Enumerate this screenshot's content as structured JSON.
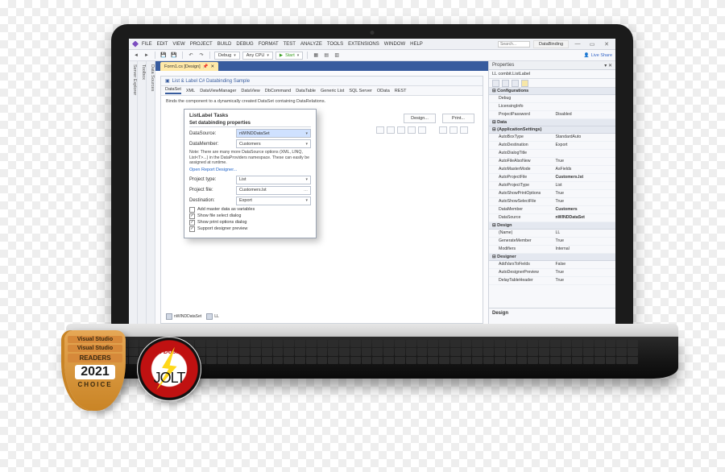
{
  "menu": [
    "FILE",
    "EDIT",
    "VIEW",
    "PROJECT",
    "BUILD",
    "DEBUG",
    "FORMAT",
    "TEST",
    "ANALYZE",
    "TOOLS",
    "EXTENSIONS",
    "WINDOW",
    "HELP"
  ],
  "search_ph": "Search...",
  "solution_tag": "DataBinding",
  "toolbar": {
    "config": "Debug",
    "platform": "Any CPU",
    "start": "Start"
  },
  "liveshare": "Live Share",
  "rails": [
    "Server Explorer",
    "Toolbox",
    "Data Sources"
  ],
  "doc_tab": "Form1.cs [Design]",
  "designer_title": "List & Label C# Databinding Sample",
  "ds_tabs": [
    "DataSet",
    "XML",
    "DataViewManager",
    "DataView",
    "DbCommand",
    "DataTable",
    "Generic List",
    "SQL Server",
    "OData",
    "REST"
  ],
  "ds_note": "Binds the component to a dynamically created DataSet containing DataRelations.",
  "btn_design": "Design...",
  "btn_print": "Print...",
  "popup": {
    "title": "ListLabel Tasks",
    "subtitle": "Set databinding properties",
    "datasource_lbl": "DataSource:",
    "datasource_val": "nWINDDataSet",
    "datamember_lbl": "DataMember:",
    "datamember_val": "Customers",
    "note": "Note: There are many more DataSource options (XML, LINQ, List<T>...) in the DataProviders namespace. These can easily be assigned at runtime.",
    "link": "Open Report Designer...",
    "projtype_lbl": "Project type:",
    "projtype_val": "List",
    "projfile_lbl": "Project file:",
    "projfile_val": "Customers.lst",
    "dest_lbl": "Destination:",
    "dest_val": "Export",
    "chk_master": "Add master data as variables",
    "chk_file": "Show file select dialog",
    "chk_print": "Show print options dialog",
    "chk_prev": "Support designer preview"
  },
  "tray": [
    "nWINDDataSet",
    "LL"
  ],
  "props": {
    "panel": "Properties",
    "selected": "LL  combit.ListLabel",
    "cats": [
      {
        "name": "Configurations",
        "items": [
          [
            "Debug",
            ""
          ],
          [
            "LicensingInfo",
            ""
          ],
          [
            "ProjectPassword",
            "Disabled"
          ]
        ]
      },
      {
        "name": "Data",
        "items": []
      },
      {
        "name": "(ApplicationSettings)",
        "items": [
          [
            "AutoBoxType",
            "StandardAuto"
          ],
          [
            "AutoDestination",
            "Export"
          ],
          [
            "AutoDialogTitle",
            ""
          ],
          [
            "AutoFileAlsoNew",
            "True"
          ],
          [
            "AutoMasterMode",
            "AsFields"
          ],
          [
            "AutoProjectFile",
            "Customers.lst"
          ],
          [
            "AutoProjectType",
            "List"
          ],
          [
            "AutoShowPrintOptions",
            "True"
          ],
          [
            "AutoShowSelectFile",
            "True"
          ],
          [
            "DataMember",
            "Customers"
          ],
          [
            "DataSource",
            "nWINDDataSet"
          ]
        ]
      },
      {
        "name": "Design",
        "items": [
          [
            "(Name)",
            "LL"
          ],
          [
            "GenerateMember",
            "True"
          ],
          [
            "Modifiers",
            "Internal"
          ]
        ]
      },
      {
        "name": "Designer",
        "items": [
          [
            "AddVarsToFields",
            "False"
          ],
          [
            "AutoDesignerPreview",
            "True"
          ],
          [
            "DelayTableHeader",
            "True"
          ]
        ]
      }
    ],
    "desc": "Design"
  },
  "badge": {
    "vs": "Visual Studio",
    "readers": "READERS",
    "year": "2021",
    "choice": "CHOICE",
    "jolt_top": "Dr. Dobb's",
    "jolt": "JOLT"
  }
}
